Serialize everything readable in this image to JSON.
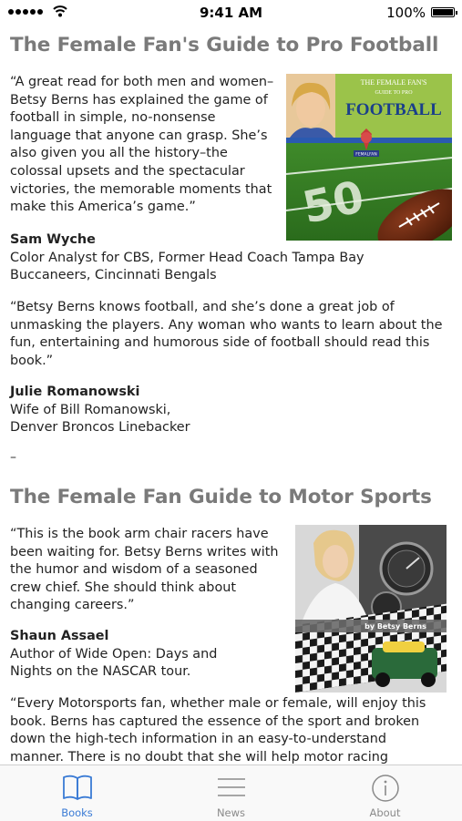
{
  "status_bar": {
    "time": "9:41 AM",
    "battery": "100%"
  },
  "books": [
    {
      "title": "The Female Fan's Guide to Pro Football",
      "cover": {
        "top_text": "THE FEMALE FAN'S",
        "sub_text": "GUIDE TO PRO",
        "main_text": "FOOTBALL",
        "badge": "FEMALFAN"
      },
      "quote1_lines": [
        "“A great read for both men and women–",
        "Betsy Berns has explained the game of",
        "football in simple, no-nonsense",
        "language that anyone can grasp. She’s",
        "also given you all the history–the",
        "colossal upsets and the spectacular",
        "victories, the memorable moments that",
        "make this America’s game.”"
      ],
      "author1": "Sam Wyche",
      "author1_role_lines": [
        "Color Analyst for CBS, Former Head Coach Tampa Bay",
        "Buccaneers, Cincinnati Bengals"
      ],
      "quote2_lines": [
        "“Betsy Berns knows football, and she’s done a great job of",
        "unmasking the players. Any woman who wants to learn about the",
        "fun, entertaining and humorous side of football should read this",
        "book.”"
      ],
      "author2": "Julie Romanowski",
      "author2_role_lines": [
        "Wife of Bill Romanowski,",
        "Denver Broncos Linebacker"
      ],
      "separator": "–"
    },
    {
      "title": "The Female Fan Guide to Motor Sports",
      "cover": {
        "byline": "by Betsy Berns"
      },
      "quote1_lines": [
        "“This is the book arm chair racers have",
        "been waiting for. Betsy Berns writes with",
        "the humor and wisdom of a seasoned",
        "crew chief. She should think about",
        "changing careers.”"
      ],
      "author1": "Shaun Assael",
      "author1_role_lines": [
        "Author of Wide Open: Days and",
        "Nights on the NASCAR tour."
      ],
      "quote2_lines": [
        "“Every Motorsports fan, whether male or female, will enjoy this",
        "book. Berns has captured the essence of the sport and broken",
        "down the high-tech information in an easy-to-understand",
        "manner. There is no doubt that she will help motor racing"
      ]
    }
  ],
  "tabs": [
    {
      "label": "Books",
      "icon": "book-icon",
      "active": true
    },
    {
      "label": "News",
      "icon": "menu-lines-icon",
      "active": false
    },
    {
      "label": "About",
      "icon": "info-icon",
      "active": false
    }
  ],
  "colors": {
    "accent": "#3a7bd5",
    "title_gray": "#7a7a7a",
    "tab_inactive": "#8a8a8a"
  }
}
